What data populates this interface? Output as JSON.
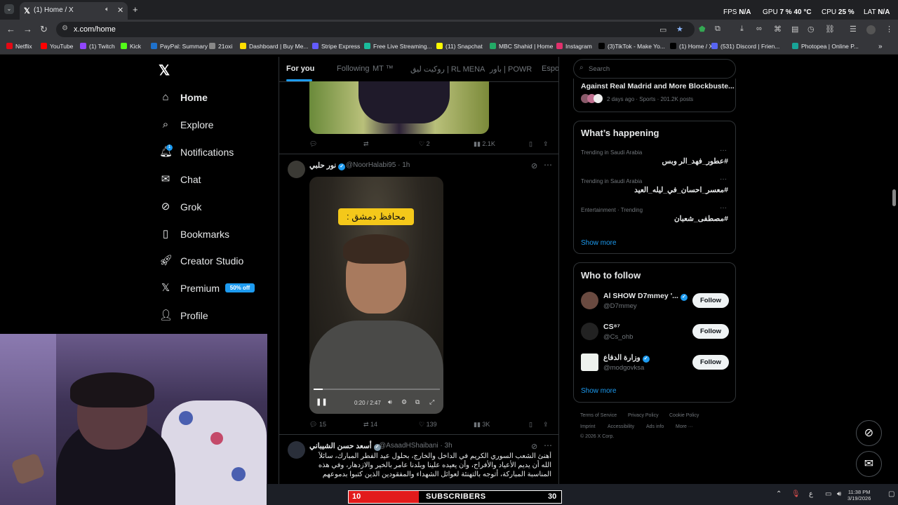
{
  "browser": {
    "tab_title": "(1) Home / X",
    "url": "x.com/home",
    "perf": {
      "fps_label": "FPS",
      "fps": "N/A",
      "gpu_label": "GPU",
      "gpu": "7 %",
      "gpu_temp": "40 °C",
      "cpu_label": "CPU",
      "cpu": "25 %",
      "lat_label": "LAT",
      "lat": "N/A"
    },
    "bookmarks": [
      {
        "label": "Netflix",
        "color": "#e50914"
      },
      {
        "label": "YouTube",
        "color": "#ff0000"
      },
      {
        "label": "(1) Twitch",
        "color": "#9146ff"
      },
      {
        "label": "Kick",
        "color": "#53fc18"
      },
      {
        "label": "PayPal: Summary",
        "color": "#1f72cd"
      },
      {
        "label": "21oxi",
        "color": "#888888"
      },
      {
        "label": "Dashboard | Buy Me...",
        "color": "#ffdd00"
      },
      {
        "label": "Stripe Express",
        "color": "#635bff"
      },
      {
        "label": "Free Live Streaming...",
        "color": "#1abc9c"
      },
      {
        "label": "(11) Snapchat",
        "color": "#fffc00"
      },
      {
        "label": "MBC Shahid | Home",
        "color": "#22aa66"
      },
      {
        "label": "Instagram",
        "color": "#e1306c"
      },
      {
        "label": "(3)TikTok - Make Yo...",
        "color": "#000000"
      },
      {
        "label": "(1) Home / X",
        "color": "#000000"
      },
      {
        "label": "(531) Discord | Frien...",
        "color": "#5865f2"
      },
      {
        "label": "Photopea | Online P...",
        "color": "#18a497"
      }
    ]
  },
  "nav": {
    "items": [
      {
        "label": "Home",
        "icon": "home-icon"
      },
      {
        "label": "Explore",
        "icon": "search-icon"
      },
      {
        "label": "Notifications",
        "icon": "bell-icon"
      },
      {
        "label": "Chat",
        "icon": "mail-icon"
      },
      {
        "label": "Grok",
        "icon": "grok-icon"
      },
      {
        "label": "Bookmarks",
        "icon": "bookmark-icon"
      },
      {
        "label": "Creator Studio",
        "icon": "rocket-icon"
      },
      {
        "label": "Premium",
        "icon": "x-icon"
      },
      {
        "label": "Profile",
        "icon": "person-icon"
      }
    ],
    "premium_badge": "50% off",
    "notif_count": "1"
  },
  "feed": {
    "tabs": [
      "For you",
      "Following",
      "MT ™",
      "روكيت ليق | RL MENA",
      "باور | POWR",
      "Espor"
    ],
    "post1_actions": {
      "replies": "",
      "reposts": "",
      "likes": "2",
      "views": "2.1K"
    },
    "post2": {
      "name": "نور حلبي",
      "handle": "@NoorHalabi95",
      "time": "· 1h",
      "video_caption": "محافظ دمشق :",
      "video_time": "0:20 / 2:47",
      "replies": "15",
      "reposts": "14",
      "likes": "139",
      "views": "3K"
    },
    "post3": {
      "name": "أسعد حسن الشيباني",
      "handle": "@AsaadHShaibani",
      "time": "· 3h",
      "text": "أهنئ الشعب السوري الكريم في الداخل والخارج، بحلول عيد الفطر المبارك، سائلاً الله أن يديم الأعياد والأفراح، وأن يعيده علينا وبلدنا عامر بالخير والازدهار، وفي هذه المناسبة المباركة، أتوجه بالتهنئة لعوائل الشهداء والمفقودين الذين كتبوا بدموعهم"
    }
  },
  "sidebar": {
    "search_placeholder": "Search",
    "top_story": {
      "title": "Against Real Madrid and More Blockbuste...",
      "meta": "2 days ago · Sports · 201.2K posts"
    },
    "happening_title": "What’s happening",
    "trends": [
      {
        "context": "Trending in Saudi Arabia",
        "tag": "#عطور_فهد_الر   وبس"
      },
      {
        "context": "Trending in Saudi Arabia",
        "tag": "#معسر_احسان_في_ليله_العيد"
      },
      {
        "context": "Entertainment · Trending",
        "tag": "#مصطفى_شعبان"
      }
    ],
    "show_more": "Show more",
    "who_title": "Who to follow",
    "follow": [
      {
        "name": "Al SHOW D7mmey '...",
        "handle": "@D7mmey",
        "verified": true
      },
      {
        "name": "CS⁸⁷",
        "handle": "@Cs_ohb",
        "verified": false
      },
      {
        "name": "وزارة الدفاع",
        "handle": "@modgovksa",
        "verified": true
      }
    ],
    "follow_label": "Follow",
    "footer": [
      "Terms of Service",
      "Privacy Policy",
      "Cookie Policy",
      "Imprint",
      "Accessibility",
      "Ads info",
      "More ···"
    ],
    "copyright": "© 2026 X Corp."
  },
  "overlay": {
    "left_num": "10",
    "label": "SUBSCRIBERS",
    "right_num": "30"
  },
  "taskbar": {
    "time": "11:38 PM",
    "date": "3/19/2026",
    "lang": "ع"
  }
}
